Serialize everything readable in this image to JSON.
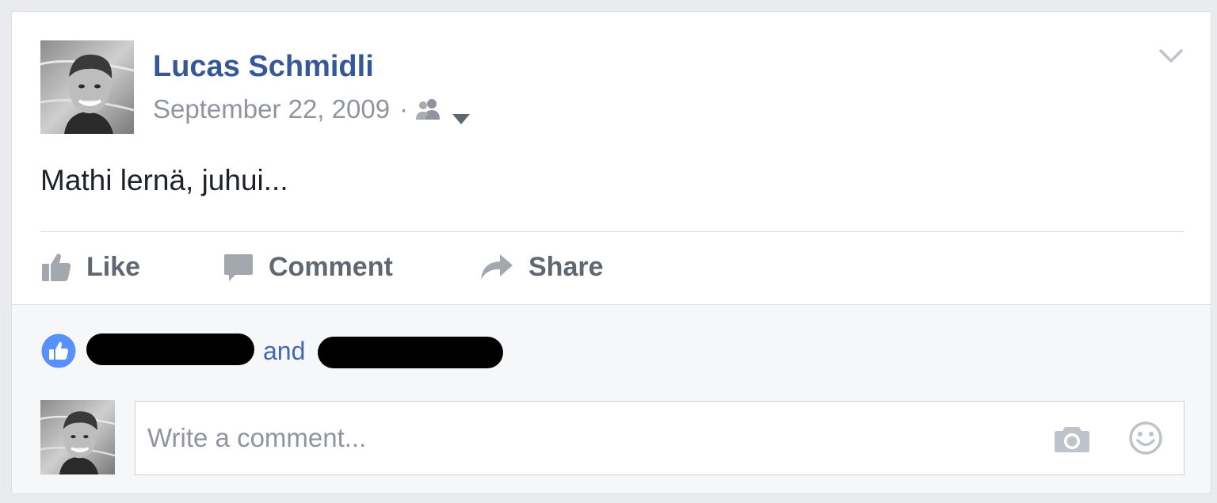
{
  "post": {
    "author": "Lucas Schmidli",
    "date": "September 22, 2009",
    "separator": "·",
    "privacy_icon": "friends-icon",
    "text": "Mathi lernä, juhui..."
  },
  "actions": {
    "like": {
      "label": "Like",
      "icon": "thumbs-up-icon"
    },
    "comment": {
      "label": "Comment",
      "icon": "speech-bubble-icon"
    },
    "share": {
      "label": "Share",
      "icon": "share-arrow-icon"
    }
  },
  "likes": {
    "connector": "and",
    "icon": "like-badge-icon"
  },
  "comment_box": {
    "placeholder": "Write a comment...",
    "camera_icon": "camera-icon",
    "emoji_icon": "emoji-icon"
  },
  "colors": {
    "author_link": "#365899",
    "meta_text": "#90949c",
    "action_text": "#616770",
    "like_blue": "#5890ff",
    "footer_bg": "#f6f7f9",
    "page_bg": "#e9ebee"
  }
}
